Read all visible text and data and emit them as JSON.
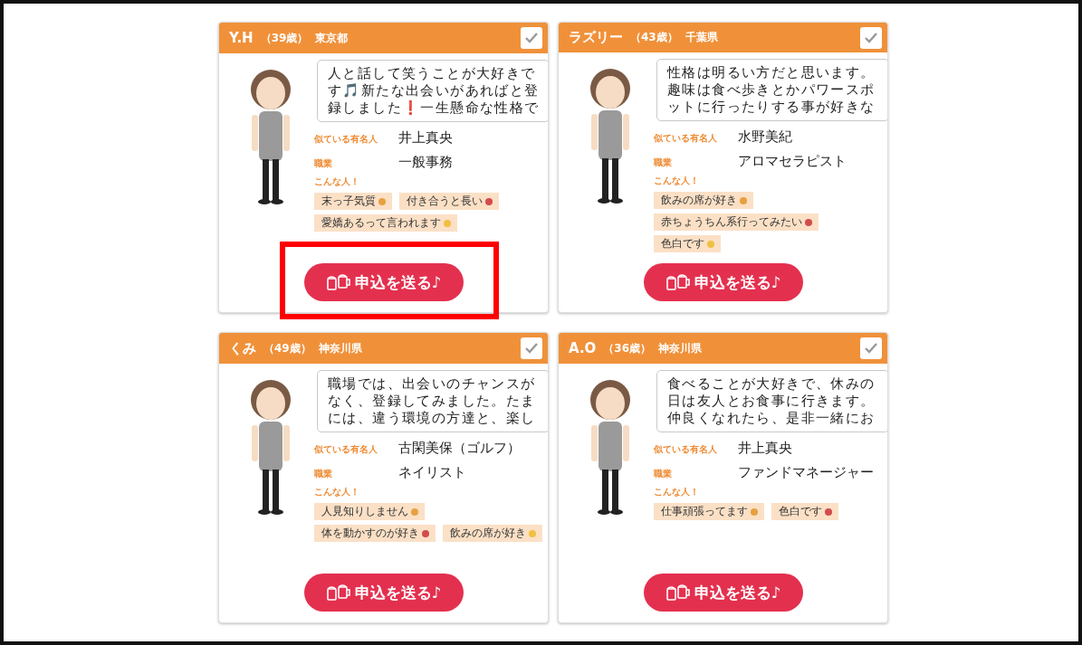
{
  "profiles": [
    {
      "name": "Y.H",
      "age": "（39歳）",
      "prefecture": "東京都",
      "checked": true,
      "highlighted": true,
      "message": "人と話して笑うことが大好きです🎵新たな出会いがあればと登録しました❗一生懸命な性格で",
      "celebrity_label": "似ている有名人",
      "celebrity": "井上真央",
      "job_label": "職業",
      "job": "一般事務",
      "traits_label": "こんな人！",
      "traits": [
        "末っ子気質",
        "付き合うと長い",
        "愛嬌あるって言われます"
      ],
      "button": "申込を送る♪"
    },
    {
      "name": "ラズリー",
      "age": "（43歳）",
      "prefecture": "千葉県",
      "checked": true,
      "highlighted": false,
      "message": "性格は明るい方だと思います。趣味は食べ歩きとかパワースポットに行ったりする事が好きな",
      "celebrity_label": "似ている有名人",
      "celebrity": "水野美紀",
      "job_label": "職業",
      "job": "アロマセラピスト",
      "traits_label": "こんな人！",
      "traits": [
        "飲みの席が好き",
        "赤ちょうちん系行ってみたい",
        "色白です"
      ],
      "button": "申込を送る♪"
    },
    {
      "name": "くみ",
      "age": "（49歳）",
      "prefecture": "神奈川県",
      "checked": true,
      "highlighted": false,
      "message": "職場では、出会いのチャンスがなく、登録してみました。たまには、違う環境の方達と、楽し",
      "celebrity_label": "似ている有名人",
      "celebrity": "古閑美保（ゴルフ）",
      "job_label": "職業",
      "job": "ネイリスト",
      "traits_label": "こんな人！",
      "traits": [
        "人見知りしません",
        "体を動かすのが好き",
        "飲みの席が好き"
      ],
      "button": "申込を送る♪"
    },
    {
      "name": "A.O",
      "age": "（36歳）",
      "prefecture": "神奈川県",
      "checked": true,
      "highlighted": false,
      "message": "食べることが大好きで、休みの日は友人とお食事に行きます。仲良くなれたら、是非一緒にお",
      "celebrity_label": "似ている有名人",
      "celebrity": "井上真央",
      "job_label": "職業",
      "job": "ファンドマネージャー",
      "traits_label": "こんな人！",
      "traits": [
        "仕事頑張ってます",
        "色白です"
      ],
      "button": "申込を送る♪"
    }
  ]
}
